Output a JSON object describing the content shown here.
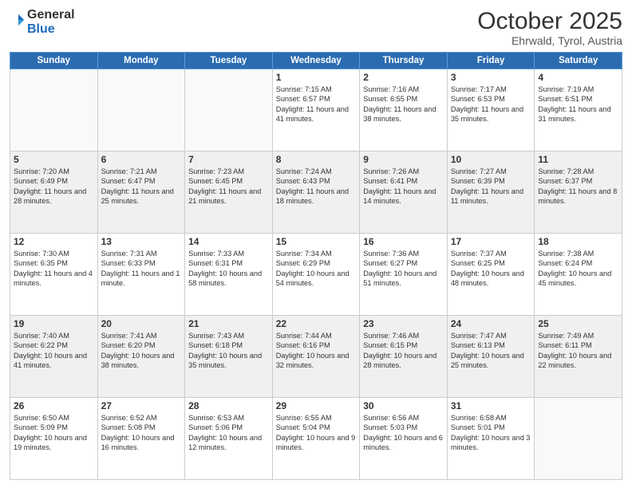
{
  "header": {
    "logo_general": "General",
    "logo_blue": "Blue",
    "month_title": "October 2025",
    "location": "Ehrwald, Tyrol, Austria"
  },
  "days_of_week": [
    "Sunday",
    "Monday",
    "Tuesday",
    "Wednesday",
    "Thursday",
    "Friday",
    "Saturday"
  ],
  "weeks": [
    [
      {
        "day": "",
        "content": ""
      },
      {
        "day": "",
        "content": ""
      },
      {
        "day": "",
        "content": ""
      },
      {
        "day": "1",
        "content": "Sunrise: 7:15 AM\nSunset: 6:57 PM\nDaylight: 11 hours and 41 minutes."
      },
      {
        "day": "2",
        "content": "Sunrise: 7:16 AM\nSunset: 6:55 PM\nDaylight: 11 hours and 38 minutes."
      },
      {
        "day": "3",
        "content": "Sunrise: 7:17 AM\nSunset: 6:53 PM\nDaylight: 11 hours and 35 minutes."
      },
      {
        "day": "4",
        "content": "Sunrise: 7:19 AM\nSunset: 6:51 PM\nDaylight: 11 hours and 31 minutes."
      }
    ],
    [
      {
        "day": "5",
        "content": "Sunrise: 7:20 AM\nSunset: 6:49 PM\nDaylight: 11 hours and 28 minutes."
      },
      {
        "day": "6",
        "content": "Sunrise: 7:21 AM\nSunset: 6:47 PM\nDaylight: 11 hours and 25 minutes."
      },
      {
        "day": "7",
        "content": "Sunrise: 7:23 AM\nSunset: 6:45 PM\nDaylight: 11 hours and 21 minutes."
      },
      {
        "day": "8",
        "content": "Sunrise: 7:24 AM\nSunset: 6:43 PM\nDaylight: 11 hours and 18 minutes."
      },
      {
        "day": "9",
        "content": "Sunrise: 7:26 AM\nSunset: 6:41 PM\nDaylight: 11 hours and 14 minutes."
      },
      {
        "day": "10",
        "content": "Sunrise: 7:27 AM\nSunset: 6:39 PM\nDaylight: 11 hours and 11 minutes."
      },
      {
        "day": "11",
        "content": "Sunrise: 7:28 AM\nSunset: 6:37 PM\nDaylight: 11 hours and 8 minutes."
      }
    ],
    [
      {
        "day": "12",
        "content": "Sunrise: 7:30 AM\nSunset: 6:35 PM\nDaylight: 11 hours and 4 minutes."
      },
      {
        "day": "13",
        "content": "Sunrise: 7:31 AM\nSunset: 6:33 PM\nDaylight: 11 hours and 1 minute."
      },
      {
        "day": "14",
        "content": "Sunrise: 7:33 AM\nSunset: 6:31 PM\nDaylight: 10 hours and 58 minutes."
      },
      {
        "day": "15",
        "content": "Sunrise: 7:34 AM\nSunset: 6:29 PM\nDaylight: 10 hours and 54 minutes."
      },
      {
        "day": "16",
        "content": "Sunrise: 7:36 AM\nSunset: 6:27 PM\nDaylight: 10 hours and 51 minutes."
      },
      {
        "day": "17",
        "content": "Sunrise: 7:37 AM\nSunset: 6:25 PM\nDaylight: 10 hours and 48 minutes."
      },
      {
        "day": "18",
        "content": "Sunrise: 7:38 AM\nSunset: 6:24 PM\nDaylight: 10 hours and 45 minutes."
      }
    ],
    [
      {
        "day": "19",
        "content": "Sunrise: 7:40 AM\nSunset: 6:22 PM\nDaylight: 10 hours and 41 minutes."
      },
      {
        "day": "20",
        "content": "Sunrise: 7:41 AM\nSunset: 6:20 PM\nDaylight: 10 hours and 38 minutes."
      },
      {
        "day": "21",
        "content": "Sunrise: 7:43 AM\nSunset: 6:18 PM\nDaylight: 10 hours and 35 minutes."
      },
      {
        "day": "22",
        "content": "Sunrise: 7:44 AM\nSunset: 6:16 PM\nDaylight: 10 hours and 32 minutes."
      },
      {
        "day": "23",
        "content": "Sunrise: 7:46 AM\nSunset: 6:15 PM\nDaylight: 10 hours and 28 minutes."
      },
      {
        "day": "24",
        "content": "Sunrise: 7:47 AM\nSunset: 6:13 PM\nDaylight: 10 hours and 25 minutes."
      },
      {
        "day": "25",
        "content": "Sunrise: 7:49 AM\nSunset: 6:11 PM\nDaylight: 10 hours and 22 minutes."
      }
    ],
    [
      {
        "day": "26",
        "content": "Sunrise: 6:50 AM\nSunset: 5:09 PM\nDaylight: 10 hours and 19 minutes."
      },
      {
        "day": "27",
        "content": "Sunrise: 6:52 AM\nSunset: 5:08 PM\nDaylight: 10 hours and 16 minutes."
      },
      {
        "day": "28",
        "content": "Sunrise: 6:53 AM\nSunset: 5:06 PM\nDaylight: 10 hours and 12 minutes."
      },
      {
        "day": "29",
        "content": "Sunrise: 6:55 AM\nSunset: 5:04 PM\nDaylight: 10 hours and 9 minutes."
      },
      {
        "day": "30",
        "content": "Sunrise: 6:56 AM\nSunset: 5:03 PM\nDaylight: 10 hours and 6 minutes."
      },
      {
        "day": "31",
        "content": "Sunrise: 6:58 AM\nSunset: 5:01 PM\nDaylight: 10 hours and 3 minutes."
      },
      {
        "day": "",
        "content": ""
      }
    ]
  ]
}
